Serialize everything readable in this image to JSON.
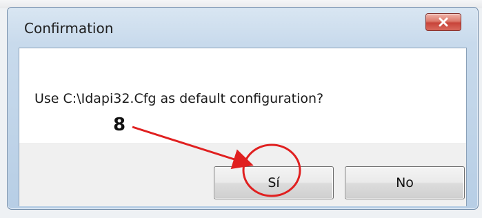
{
  "dialog": {
    "title": "Confirmation",
    "message": "Use C:\\Idapi32.Cfg as default configuration?",
    "buttons": {
      "yes_label": "Sí",
      "no_label": "No"
    },
    "close_icon": "close-icon"
  },
  "annotation": {
    "step_number": "8",
    "color": "#e02020"
  },
  "colors": {
    "close_button": "#c8443a",
    "titlebar": "#c8daec"
  }
}
